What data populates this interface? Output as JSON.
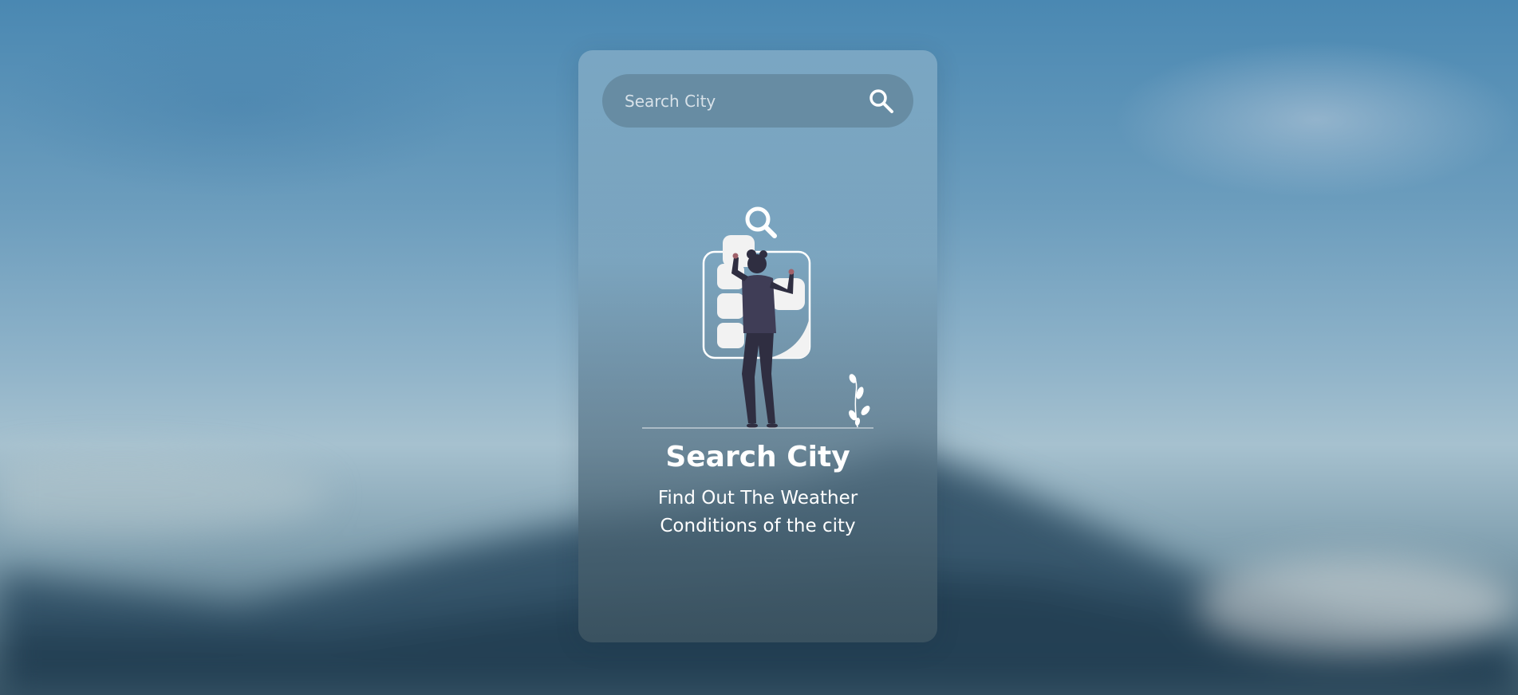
{
  "search": {
    "placeholder": "Search City",
    "icon": "search-icon"
  },
  "empty_state": {
    "title": "Search City",
    "subtitle_line1": "Find Out The Weather",
    "subtitle_line2": "Conditions of the city"
  },
  "colors": {
    "text": "#ffffff",
    "figure_dark": "#2f2e41",
    "accent_hand": "#a0616a"
  }
}
